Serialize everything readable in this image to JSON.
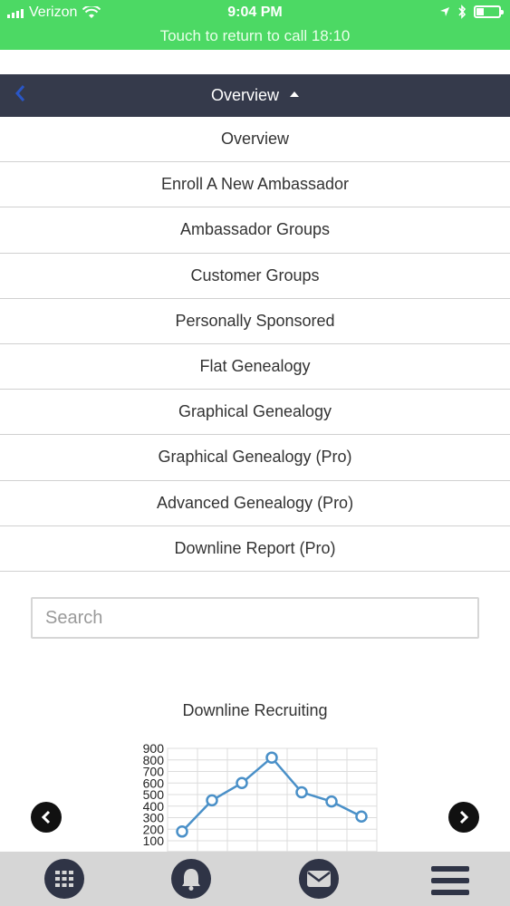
{
  "status_bar": {
    "carrier": "Verizon",
    "time": "9:04 PM",
    "call_banner": "Touch to return to call 18:10",
    "battery_level": 0.35
  },
  "header": {
    "title": "Overview"
  },
  "menu": {
    "items": [
      "Overview",
      "Enroll A New Ambassador",
      "Ambassador Groups",
      "Customer Groups",
      "Personally Sponsored",
      "Flat Genealogy",
      "Graphical Genealogy",
      "Graphical Genealogy (Pro)",
      "Advanced Genealogy (Pro)",
      "Downline Report (Pro)"
    ]
  },
  "search": {
    "placeholder": "Search"
  },
  "chart_data": {
    "type": "line",
    "title": "Downline Recruiting",
    "y_ticks": [
      "900",
      "800",
      "700",
      "600",
      "500",
      "400",
      "300",
      "200",
      "100"
    ],
    "ylim": [
      100,
      900
    ],
    "values": [
      180,
      450,
      600,
      820,
      520,
      440,
      310
    ],
    "grid": true,
    "line_color": "#4a90c8"
  },
  "colors": {
    "status_green": "#4cd964",
    "header_bg": "#353a4b",
    "tab_icon_bg": "#2f3446"
  },
  "tab_bar": {
    "icons": [
      "grid-icon",
      "bell-icon",
      "mail-icon",
      "menu-icon"
    ]
  }
}
